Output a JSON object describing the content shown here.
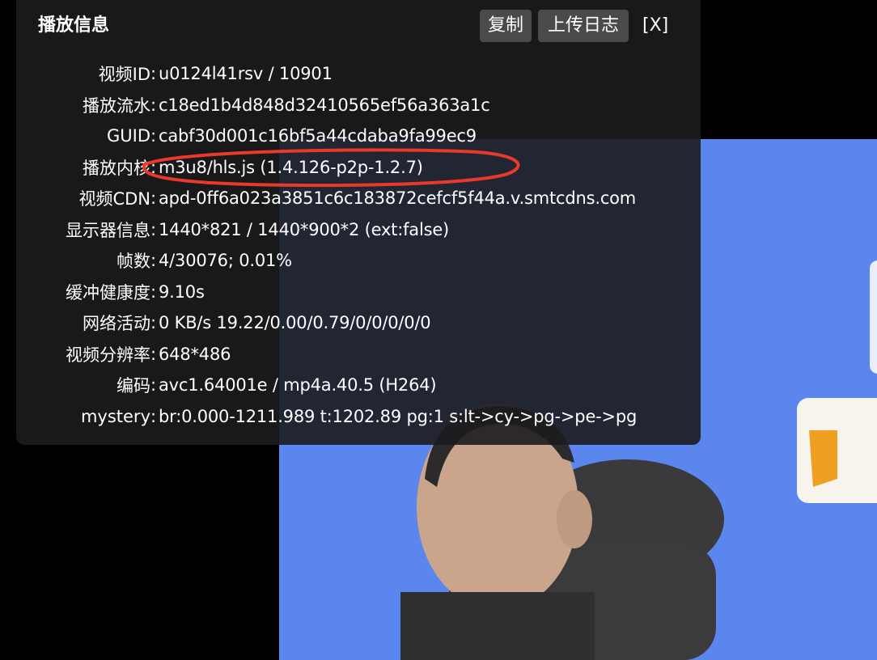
{
  "panel": {
    "title": "播放信息",
    "copy_label": "复制",
    "upload_log_label": "上传日志",
    "close_label": "[X]"
  },
  "rows": [
    {
      "label": "视频ID",
      "value": "u0124l41rsv / 10901"
    },
    {
      "label": "播放流水",
      "value": "c18ed1b4d848d32410565ef56a363a1c"
    },
    {
      "label": "GUID",
      "value": "cabf30d001c16bf5a44cdaba9fa99ec9"
    },
    {
      "label": "播放内核",
      "value": "m3u8/hls.js (1.4.126-p2p-1.2.7)"
    },
    {
      "label": "视频CDN",
      "value": "apd-0ff6a023a3851c6c183872cefcf5f44a.v.smtcdns.com"
    },
    {
      "label": "显示器信息",
      "value": "1440*821 / 1440*900*2 (ext:false)"
    },
    {
      "label": "帧数",
      "value": "4/30076; 0.01%"
    },
    {
      "label": "缓冲健康度",
      "value": "9.10s"
    },
    {
      "label": "网络活动",
      "value": "0 KB/s 19.22/0.00/0.79/0/0/0/0/0"
    },
    {
      "label": "视频分辨率",
      "value": "648*486"
    },
    {
      "label": "编码",
      "value": "avc1.64001e / mp4a.40.5 (H264)"
    },
    {
      "label": "mystery",
      "value": "br:0.000-1211.989 t:1202.89 pg:1 s:lt->cy->pg->pe->pg"
    }
  ],
  "colors": {
    "panel_background": "#1c1c1e",
    "button_background": "#4a4a4c",
    "annotation": "#e8392a",
    "video_background": "#5a86ee"
  },
  "annotation": {
    "target_row": "播放内核",
    "shape": "ellipse"
  }
}
